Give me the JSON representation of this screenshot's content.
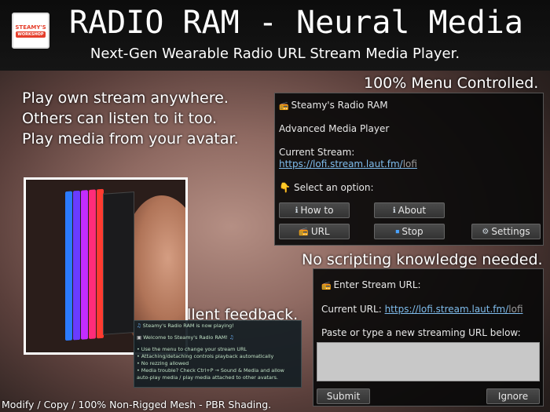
{
  "header": {
    "logo_line1": "STEAMY'S",
    "logo_line2": "WORKSHOP",
    "title": "RADIO RAM - Neural Media",
    "subtitle": "Next-Gen Wearable Radio URL Stream Media Player."
  },
  "features": {
    "line1": "Play own stream anywhere.",
    "line2": "Others can listen to it too.",
    "line3": "Play media from your avatar."
  },
  "captions": {
    "menu": "100% Menu Controlled.",
    "scripting": "No scripting knowledge needed.",
    "feedback": "Excellent feedback."
  },
  "menu_dialog": {
    "title_icon": "radio-icon",
    "title": "Steamy's Radio RAM",
    "subtitle": "Advanced Media Player",
    "current_label": "Current Stream:",
    "current_url": "https://lofi.stream.laut.fm/",
    "current_url_tail": "lofi",
    "option_prompt": "Select an option:",
    "buttons": {
      "how_to": "How to",
      "about": "About",
      "url": "URL",
      "stop": "Stop",
      "settings": "Settings"
    }
  },
  "url_dialog": {
    "title": "Enter Stream URL:",
    "current_label": "Current URL:",
    "current_url": "https://lofi.stream.laut.fm/",
    "current_url_tail": "lofi",
    "paste_prompt": "Paste or type a new streaming URL below:",
    "input_value": "",
    "submit": "Submit",
    "ignore": "Ignore"
  },
  "chat": {
    "line1": "Steamy's Radio RAM is now playing!",
    "line2": "Welcome to Steamy's Radio RAM!",
    "line3": "• Use the menu to change your stream URL",
    "line4": "• Attaching/detaching controls playback automatically",
    "line5": "• No rezzing allowed",
    "line6": "• Media trouble? Check Ctrl+P → Sound & Media and allow",
    "line7": "auto-play media / play media attached to other avatars."
  },
  "footer": "Modify / Copy / 100% Non-Rigged Mesh - PBR Shading.",
  "colors": {
    "link": "#7fbcec",
    "dialog_bg": "#0a0a0a",
    "accent_red": "#e53f2c",
    "led_colors": [
      "#2b7bff",
      "#6a3cff",
      "#c32cff",
      "#ff2c7a",
      "#ff3b30"
    ]
  }
}
